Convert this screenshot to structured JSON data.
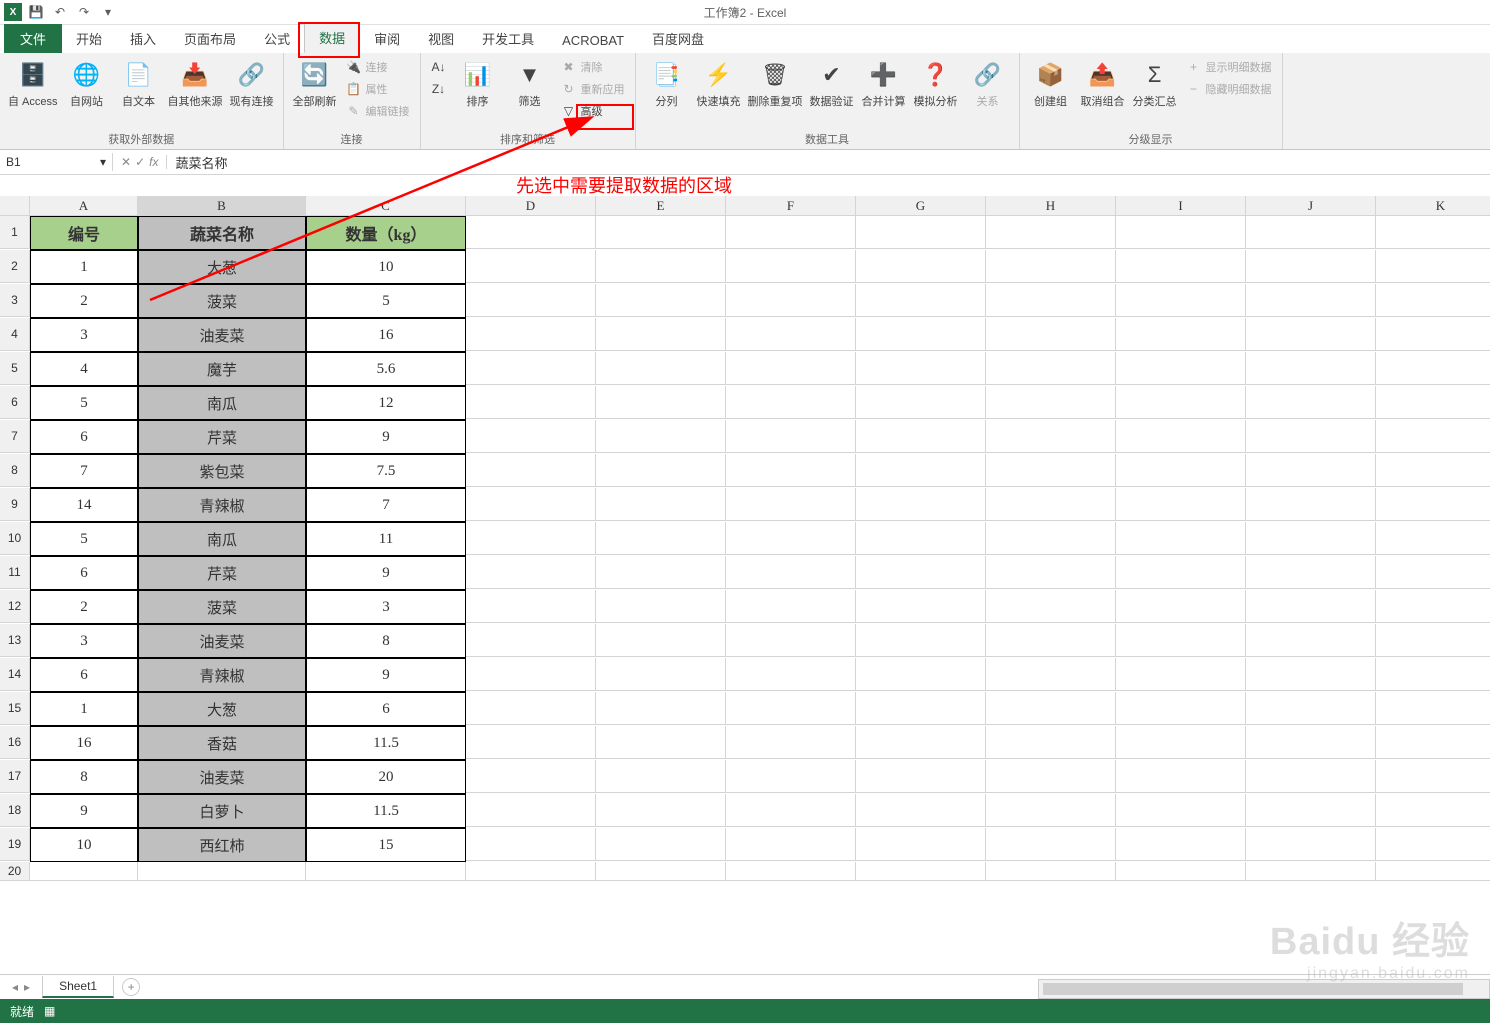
{
  "app": {
    "title": "工作簿2 - Excel"
  },
  "qat": {
    "save": "💾",
    "undo": "↶",
    "redo": "↷"
  },
  "tabs": {
    "file": "文件",
    "home": "开始",
    "insert": "插入",
    "pageLayout": "页面布局",
    "formulas": "公式",
    "data": "数据",
    "review": "审阅",
    "view": "视图",
    "dev": "开发工具",
    "acrobat": "ACROBAT",
    "baidu": "百度网盘"
  },
  "ribbon": {
    "ext_data": {
      "access": "自 Access",
      "web": "自网站",
      "text": "自文本",
      "other": "自其他来源",
      "existing": "现有连接",
      "label": "获取外部数据"
    },
    "conn": {
      "refresh": "全部刷新",
      "link": "连接",
      "prop": "属性",
      "edit": "编辑链接",
      "label": "连接"
    },
    "sort": {
      "asc": "A↓Z",
      "desc": "Z↓A",
      "sort": "排序",
      "filter": "筛选",
      "clear": "清除",
      "reapply": "重新应用",
      "advanced": "高级",
      "label": "排序和筛选"
    },
    "tools": {
      "texttocol": "分列",
      "flash": "快速填充",
      "dup": "删除重复项",
      "valid": "数据验证",
      "consol": "合并计算",
      "whatif": "模拟分析",
      "rel": "关系",
      "label": "数据工具"
    },
    "outline": {
      "group": "创建组",
      "ungroup": "取消组合",
      "subtotal": "分类汇总",
      "show": "显示明细数据",
      "hide": "隐藏明细数据",
      "label": "分级显示"
    }
  },
  "formula_bar": {
    "name": "B1",
    "fx": "fx",
    "value": "蔬菜名称"
  },
  "annotation": "先选中需要提取数据的区域",
  "columns": [
    "",
    "A",
    "B",
    "C",
    "D",
    "E",
    "F",
    "G",
    "H",
    "I",
    "J",
    "K"
  ],
  "table": {
    "headers": {
      "a": "编号",
      "b": "蔬菜名称",
      "c": "数量（kg）"
    },
    "rows": [
      {
        "a": "1",
        "b": "大葱",
        "c": "10"
      },
      {
        "a": "2",
        "b": "菠菜",
        "c": "5"
      },
      {
        "a": "3",
        "b": "油麦菜",
        "c": "16"
      },
      {
        "a": "4",
        "b": "魔芋",
        "c": "5.6"
      },
      {
        "a": "5",
        "b": "南瓜",
        "c": "12"
      },
      {
        "a": "6",
        "b": "芹菜",
        "c": "9"
      },
      {
        "a": "7",
        "b": "紫包菜",
        "c": "7.5"
      },
      {
        "a": "14",
        "b": "青辣椒",
        "c": "7"
      },
      {
        "a": "5",
        "b": "南瓜",
        "c": "11"
      },
      {
        "a": "6",
        "b": "芹菜",
        "c": "9"
      },
      {
        "a": "2",
        "b": "菠菜",
        "c": "3"
      },
      {
        "a": "3",
        "b": "油麦菜",
        "c": "8"
      },
      {
        "a": "6",
        "b": "青辣椒",
        "c": "9"
      },
      {
        "a": "1",
        "b": "大葱",
        "c": "6"
      },
      {
        "a": "16",
        "b": "香菇",
        "c": "11.5"
      },
      {
        "a": "8",
        "b": "油麦菜",
        "c": "20"
      },
      {
        "a": "9",
        "b": "白萝卜",
        "c": "11.5"
      },
      {
        "a": "10",
        "b": "西红柿",
        "c": "15"
      }
    ]
  },
  "sheet": {
    "tab": "Sheet1"
  },
  "status": {
    "ready": "就绪"
  },
  "watermark": {
    "line1": "Baidu 经验",
    "line2": "jingyan.baidu.com"
  }
}
